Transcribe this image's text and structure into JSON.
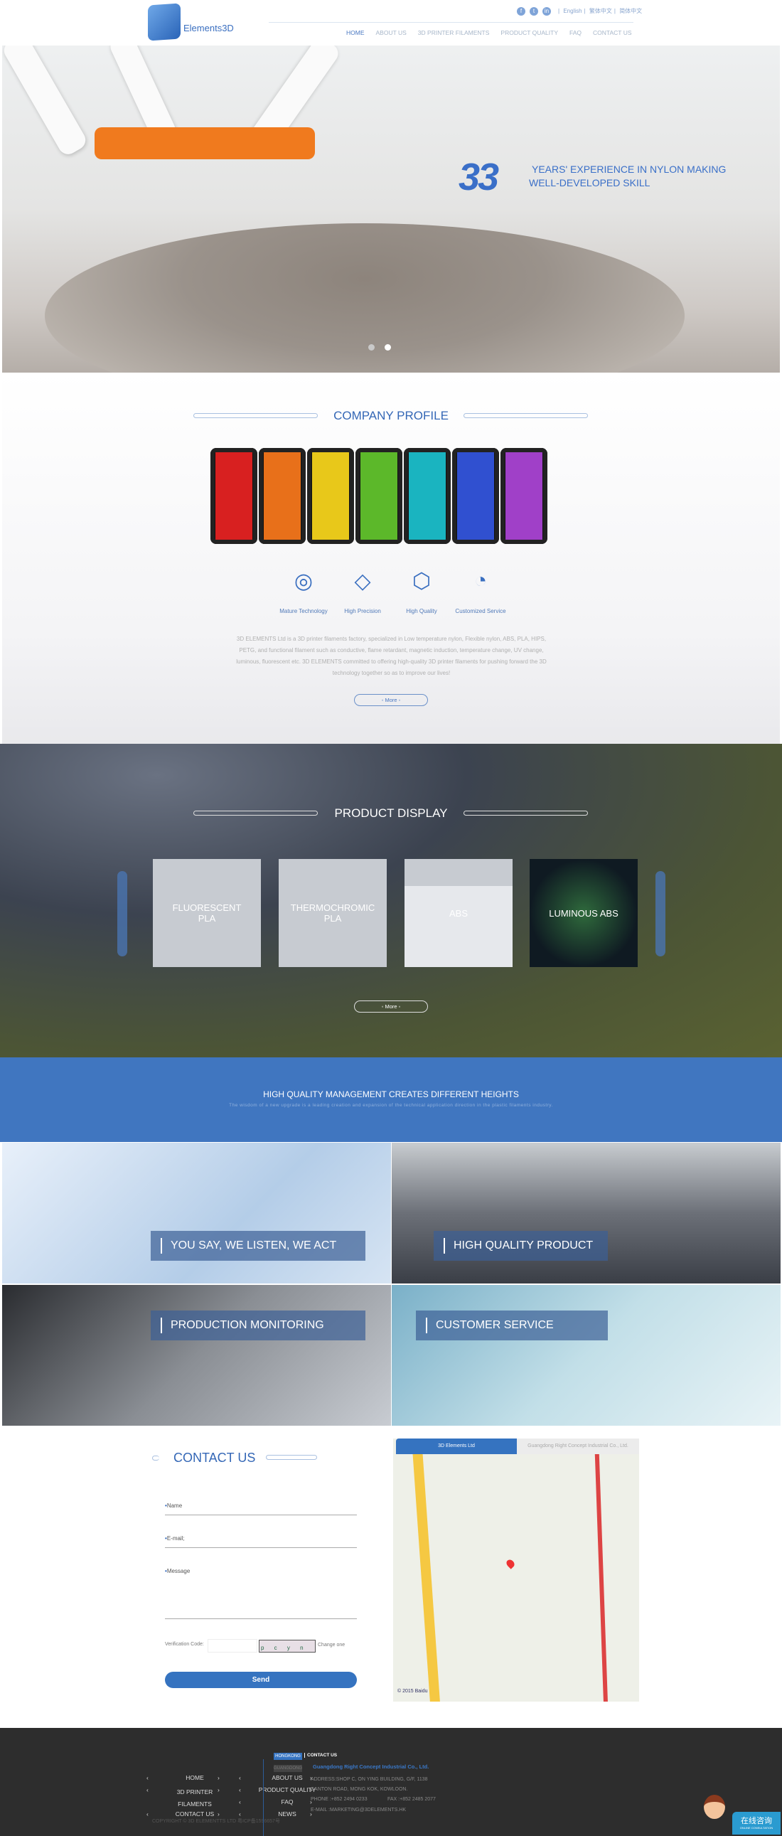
{
  "header": {
    "logo_text": "Elements3D",
    "social": [
      "f",
      "t",
      "in"
    ],
    "languages": [
      "English",
      "繁体中文",
      "简体中文"
    ],
    "nav": [
      "HOME",
      "ABOUT US",
      "3D PRINTER FILAMENTS",
      "PRODUCT QUALITY",
      "FAQ",
      "CONTACT US"
    ],
    "active_nav": "HOME"
  },
  "hero": {
    "number": "33",
    "line1": "YEARS' EXPERIENCE IN NYLON MAKING",
    "line2": "WELL-DEVELOPED SKILL",
    "slides": 2,
    "active_slide": 2
  },
  "profile": {
    "title": "COMPANY PROFILE",
    "spool_colors": [
      "#d82020",
      "#e8701a",
      "#e8c81a",
      "#5cb82a",
      "#1ab4c0",
      "#3050d0",
      "#a040c8"
    ],
    "features": [
      {
        "icon": "target-icon",
        "label": "Mature Technology"
      },
      {
        "icon": "diamond-icon",
        "label": "High Precision"
      },
      {
        "icon": "molecule-icon",
        "label": "High Quality"
      },
      {
        "icon": "gauge-icon",
        "label": "Customized Service"
      }
    ],
    "text": "3D ELEMENTS Ltd is a 3D printer filaments factory, specialized in Low temperature nylon, Flexible nylon, ABS, PLA, HIPS, PETG, and functional filament such as conductive, flame retardant, magnetic induction, temperature change, UV change, luminous, fluorescent etc. 3D ELEMENTS committed to offering high-quality 3D printer filaments for pushing forward the 3D technology together so as to improve our lives!",
    "more": "◦ More ◦"
  },
  "products": {
    "title": "PRODUCT DISPLAY",
    "items": [
      "FLUORESCENT PLA",
      "THERMOCHROMIC PLA",
      "ABS",
      "LUMINOUS ABS"
    ],
    "more": "◦ More ◦"
  },
  "band": {
    "title": "HIGH QUALITY MANAGEMENT CREATES DIFFERENT HEIGHTS",
    "subtitle": "The wisdom of a new upgrade is a leading creation and expansion of the technical application direction in the plastic filaments industry."
  },
  "tiles": [
    "YOU SAY, WE LISTEN, WE ACT",
    "HIGH QUALITY PRODUCT",
    "PRODUCTION MONITORING",
    "CUSTOMER SERVICE"
  ],
  "contact": {
    "title": "CONTACT US",
    "name": "Name",
    "email": "E-mail;",
    "message": "Message",
    "verification_label": "Verification Code:",
    "captcha": "p c y n",
    "change": "Change one",
    "send": "Send",
    "map_tabs": [
      "3D Elements Ltd",
      "Guangdong Right Concept Industrial Co., Ltd."
    ],
    "map_credit": "© 2015 Baidu"
  },
  "footer": {
    "links": [
      "HOME",
      "ABOUT US",
      "3D PRINTER FILAMENTS",
      "PRODUCT QUALITY",
      "CONTACT US",
      "FAQ",
      "NEWS"
    ],
    "copyright": "COPYRIGHT © 3D ELEMENTTS  LTD  粤ICP备1596657号",
    "regions": [
      "HONGKONG",
      "GUANGDONG"
    ],
    "active_region": "HONGKONG",
    "contact_heading": "CONTACT US",
    "company": "Guangdong Right Concept Industrial Co., Ltd.",
    "address": "ADDRESS:SHOP C, ON YING BUILDING, G/F, 1138 CANTON ROAD, MONG KOK, KOWLOON.",
    "phone": "PHONE  :+852 2494 0233",
    "fax": "FAX   :+852 2485 2077",
    "email": "E-MAIL :MARKETING@3DELEMENTS.HK"
  },
  "chat": {
    "title": "在线咨询",
    "subtitle": "ONLINE CONSULTATION"
  }
}
